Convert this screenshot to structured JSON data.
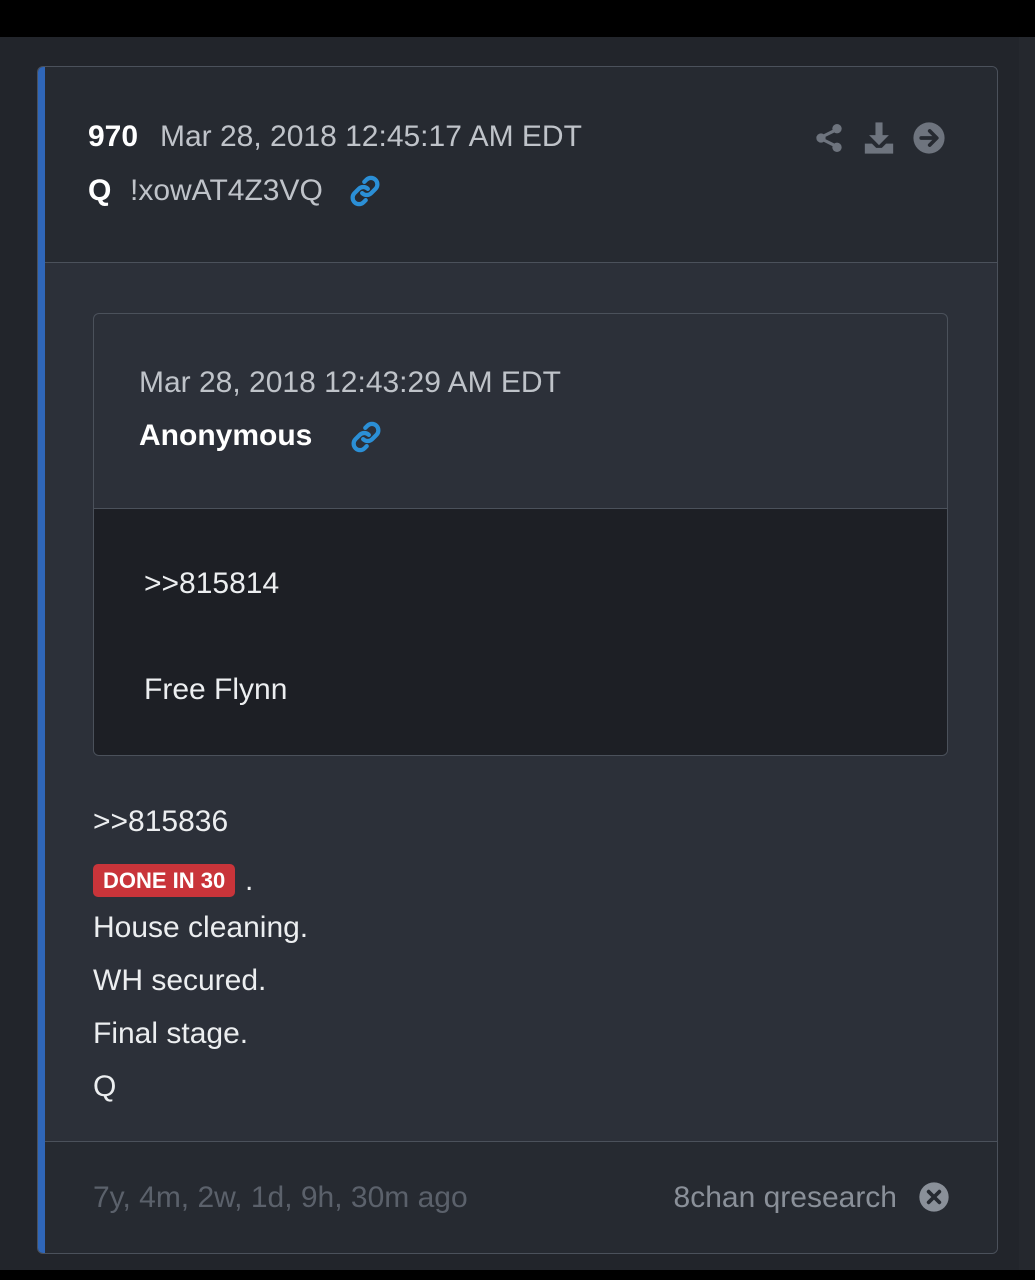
{
  "post": {
    "number": "970",
    "date": "Mar 28, 2018 12:45:17 AM EDT",
    "author": "Q",
    "tripcode": "!xowAT4Z3VQ"
  },
  "header_icons": [
    "share-icon",
    "download-icon",
    "arrow-right-circle-icon",
    "link-icon"
  ],
  "quoted": {
    "date": "Mar 28, 2018 12:43:29 AM EDT",
    "author": "Anonymous",
    "lines": [
      ">>815814",
      "Free Flynn"
    ]
  },
  "body": {
    "reply_ref": ">>815836",
    "badge": "DONE IN 30",
    "badge_suffix": ".",
    "lines": [
      "House cleaning.",
      "WH secured.",
      "Final stage.",
      "Q"
    ]
  },
  "footer": {
    "ago": "7y, 4m, 2w, 1d, 9h, 30m ago",
    "source": "8chan qresearch"
  },
  "colors": {
    "accent": "#2f66b8",
    "link": "#2b8fd6",
    "badge": "#c9343a",
    "background": "#2c3039"
  }
}
